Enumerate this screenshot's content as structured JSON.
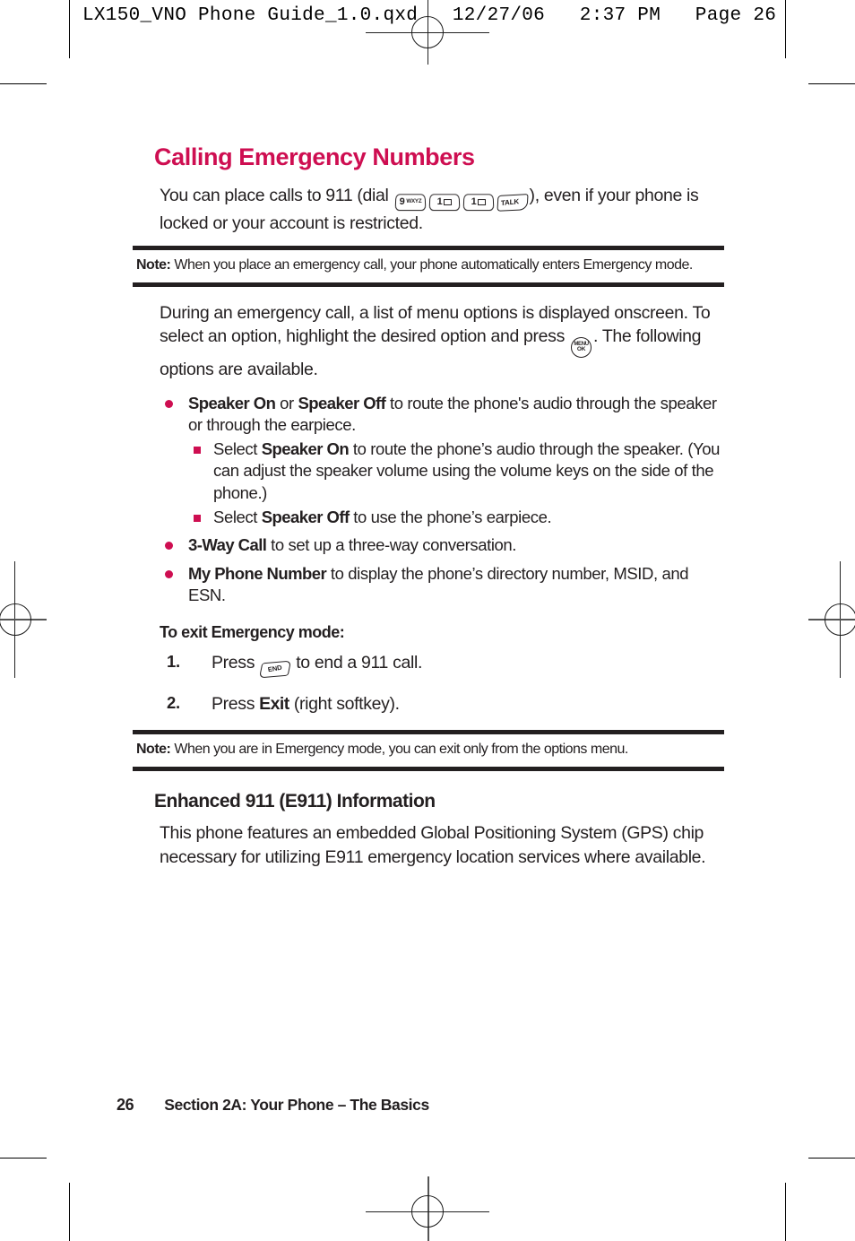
{
  "prepress": {
    "header": "LX150_VNO Phone Guide_1.0.qxd   12/27/06   2:37 PM   Page 26"
  },
  "section": {
    "title": "Calling Emergency Numbers",
    "intro_before": "You can place calls to 911 (dial ",
    "intro_after": "), even if your phone is locked or your account is restricted."
  },
  "keys": {
    "nine": {
      "digit": "9",
      "letters": "WXYZ",
      "name": "key-9-wxyz"
    },
    "one_a": {
      "digit": "1",
      "letters": "envelope",
      "name": "key-1-voicemail"
    },
    "one_b": {
      "digit": "1",
      "letters": "envelope",
      "name": "key-1-voicemail"
    },
    "talk": {
      "label": "TALK",
      "name": "key-talk"
    },
    "end": {
      "label": "END",
      "name": "key-end"
    },
    "menu": {
      "line1": "MENU",
      "line2": "OK",
      "name": "key-menu-ok"
    }
  },
  "note1": {
    "label": "Note:",
    "text": " When you place an emergency call, your phone automatically enters Emergency mode."
  },
  "note2": {
    "label": "Note:",
    "text": " When you are in Emergency mode, you can exit only from the options menu."
  },
  "menu_para": {
    "before": "During an emergency call, a list of menu options is displayed onscreen. To select an option, highlight the desired option and press ",
    "after": ". The following options are available."
  },
  "options": [
    {
      "bold1": "Speaker On",
      "mid": " or ",
      "bold2": "Speaker Off",
      "rest": " to route the phone's audio through the speaker or through the earpiece.",
      "subitems": [
        {
          "before": "Select ",
          "bold": "Speaker On",
          "after": " to route the phone’s audio through the speaker. (You can adjust the speaker volume using the volume keys on the side of the phone.)"
        },
        {
          "before": "Select ",
          "bold": "Speaker Off",
          "after": " to use the phone’s earpiece."
        }
      ]
    },
    {
      "bold1": "3-Way Call",
      "rest": " to set up a three-way conversation."
    },
    {
      "bold1": "My Phone Number",
      "rest": " to display the phone’s directory number, MSID, and ESN."
    }
  ],
  "exit_heading": "To exit Emergency mode:",
  "steps": [
    {
      "num": "1.",
      "before": "Press ",
      "after": " to end a 911 call."
    },
    {
      "num": "2.",
      "before": "Press ",
      "bold": "Exit",
      "after": " (right softkey)."
    }
  ],
  "e911": {
    "heading": "Enhanced 911 (E911) Information",
    "body": "This phone features an embedded Global Positioning System (GPS) chip necessary for utilizing E911 emergency location services where available."
  },
  "footer": {
    "page_number": "26",
    "breadcrumb": "Section 2A: Your Phone – The Basics"
  },
  "colors": {
    "accent": "#CE0E51",
    "text": "#231f20"
  }
}
